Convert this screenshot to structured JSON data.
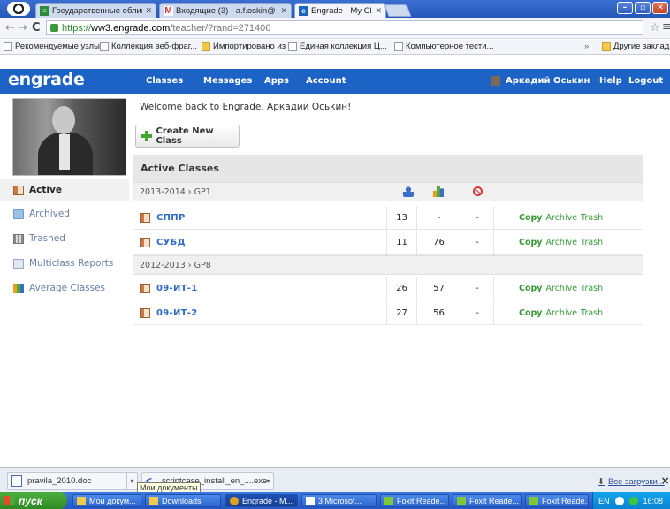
{
  "browser": {
    "tabs": [
      {
        "label": "Государственные облигац",
        "favicon": "sheet-icon",
        "active": false
      },
      {
        "label": "Входящие (3) - a.f.oskin@",
        "favicon": "gmail-icon",
        "active": false
      },
      {
        "label": "Engrade - My Classes",
        "favicon": "engrade-icon",
        "active": true
      }
    ],
    "url": {
      "scheme": "https://",
      "host": "ww3.engrade.com",
      "path": "/teacher/?rand=271406"
    },
    "bookmarks": [
      {
        "label": "Рекомендуемые узлы",
        "type": "page"
      },
      {
        "label": "Коллекция веб-фраг...",
        "type": "page"
      },
      {
        "label": "Импортировано из IE",
        "type": "folder"
      },
      {
        "label": "Единая коллекция Ц...",
        "type": "page"
      },
      {
        "label": "Компьютерное тести...",
        "type": "page"
      }
    ],
    "other_bookmarks": "Другие закладк",
    "overflow": "»"
  },
  "site": {
    "logo": "engrade",
    "nav": [
      "Classes",
      "Messages",
      "Apps",
      "Account"
    ],
    "user": "Аркадий Оськин",
    "help": "Help",
    "logout": "Logout"
  },
  "sidebar": {
    "items": [
      {
        "label": "Active",
        "icon": "book-icon",
        "active": true
      },
      {
        "label": "Archived",
        "icon": "folder-icon",
        "active": false
      },
      {
        "label": "Trashed",
        "icon": "trash-icon",
        "active": false
      },
      {
        "label": "Multiclass Reports",
        "icon": "multiclass-icon",
        "active": false
      },
      {
        "label": "Average Classes",
        "icon": "bar-chart-icon",
        "active": false
      }
    ]
  },
  "main": {
    "welcome": "Welcome back to Engrade, Аркадий Оськин!",
    "create_button": "Create New Class",
    "section_title": "Active Classes",
    "groups": [
      {
        "label": "2013-2014 › GP1",
        "classes": [
          {
            "name": "СППР",
            "students": "13",
            "average": "-",
            "missing": "-"
          },
          {
            "name": "СУБД",
            "students": "11",
            "average": "76",
            "missing": "-"
          }
        ]
      },
      {
        "label": "2012-2013 › GP8",
        "classes": [
          {
            "name": "09-ИТ-1",
            "students": "26",
            "average": "57",
            "missing": "-"
          },
          {
            "name": "09-ИТ-2",
            "students": "27",
            "average": "56",
            "missing": "-"
          }
        ]
      }
    ],
    "actions": {
      "copy": "Copy",
      "archive": "Archive",
      "trash": "Trash"
    }
  },
  "downloads": {
    "items": [
      {
        "label": "pravila_2010.doc"
      },
      {
        "label": "scriptcase_install_en_....exe"
      }
    ],
    "tooltip": "Мои документы",
    "all_label": "Все загрузки...",
    "close": "✕"
  },
  "taskbar": {
    "start": "пуск",
    "tasks": [
      {
        "label": "Мои докум...",
        "active": false
      },
      {
        "label": "Downloads",
        "active": false
      },
      {
        "label": "Engrade - M...",
        "active": true
      },
      {
        "label": "3 Microsof...",
        "active": false
      },
      {
        "label": "Foxit Reade...",
        "active": false
      },
      {
        "label": "Foxit Reade...",
        "active": false
      },
      {
        "label": "Foxit Reade...",
        "active": false
      }
    ],
    "lang": "EN",
    "clock": "16:08"
  },
  "colors": {
    "brand_blue": "#1d63c6",
    "link_blue": "#2e6bc6",
    "action_green": "#3a9a3a"
  }
}
